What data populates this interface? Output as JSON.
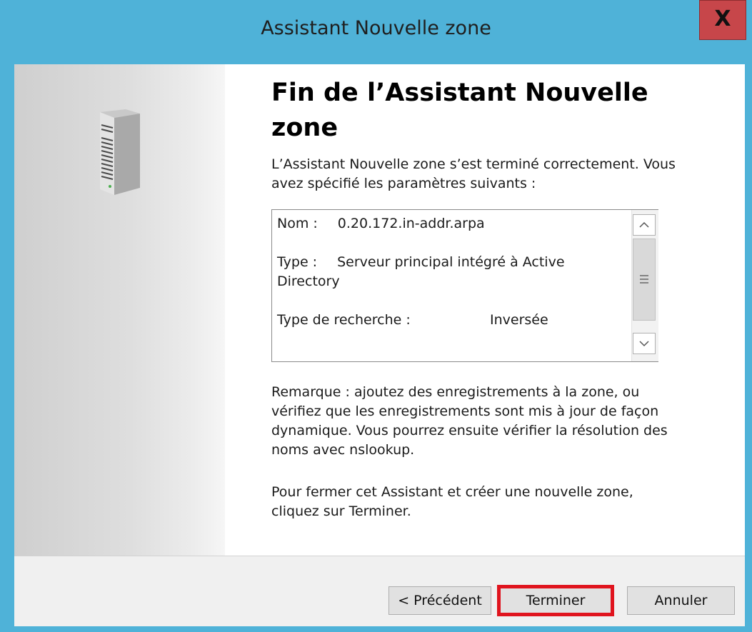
{
  "window": {
    "title": "Assistant Nouvelle zone",
    "close_glyph": "X"
  },
  "icons": {
    "server": "server-icon",
    "close": "close-icon"
  },
  "content": {
    "heading_line1": "Fin de l’Assistant Nouvelle",
    "heading_line2": "zone",
    "intro_line1": "L’Assistant Nouvelle zone s’est terminé correctement. Vous",
    "intro_line2": "avez spécifié les paramètres suivants :",
    "summary": {
      "name_label": "Nom :",
      "name_value": "0.20.172.in-addr.arpa",
      "type_label": "Type :",
      "type_value_line1": "Serveur principal intégré à Active",
      "type_value_line2": "Directory",
      "lookup_label": "Type de recherche :",
      "lookup_value": "Inversée"
    },
    "note_lines": [
      "Remarque : ajoutez des enregistrements à la zone, ou",
      "vérifiez que les enregistrements sont mis à jour de façon",
      "dynamique. Vous pourrez ensuite vérifier la résolution des",
      "noms avec nslookup."
    ],
    "close_lines": [
      "Pour fermer cet Assistant et créer une nouvelle zone,",
      "cliquez sur Terminer."
    ]
  },
  "buttons": {
    "previous": "< Précédent",
    "finish": "Terminer",
    "cancel": "Annuler"
  },
  "colors": {
    "title_bar": "#4fb2d8",
    "close_button": "#c7464a",
    "highlight": "#e0141e"
  }
}
